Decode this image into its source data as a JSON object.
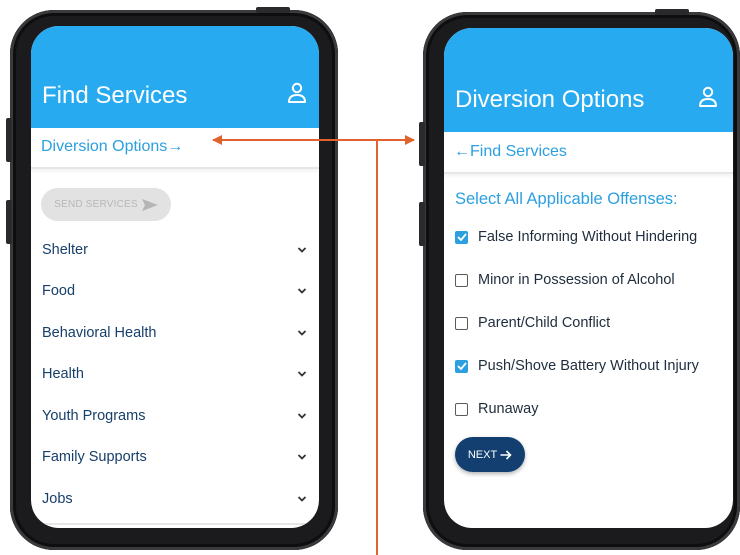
{
  "find_services_screen": {
    "title": "Find Services",
    "link_label": "Diversion Options→",
    "send_button_label": "SEND SERVICES",
    "categories": [
      {
        "label": "Shelter"
      },
      {
        "label": "Food"
      },
      {
        "label": "Behavioral Health"
      },
      {
        "label": "Health"
      },
      {
        "label": "Youth Programs"
      },
      {
        "label": "Family Supports"
      },
      {
        "label": "Jobs"
      }
    ]
  },
  "diversion_options_screen": {
    "title": "Diversion Options",
    "back_link_label": "←Find Services",
    "section_label": "Select All Applicable Offenses:",
    "offenses": [
      {
        "label": "False Informing Without Hindering",
        "checked": true
      },
      {
        "label": "Minor in Possession of Alcohol",
        "checked": false
      },
      {
        "label": "Parent/Child Conflict",
        "checked": false
      },
      {
        "label": "Push/Shove Battery Without Injury",
        "checked": true
      },
      {
        "label": "Runaway",
        "checked": false
      }
    ],
    "next_button_label": "NEXT"
  },
  "colors": {
    "header": "#28aaf0",
    "link": "#2b9fe0",
    "category_text": "#173f6b",
    "next_button": "#133f70",
    "annotation_arrow": "#e0622d"
  }
}
